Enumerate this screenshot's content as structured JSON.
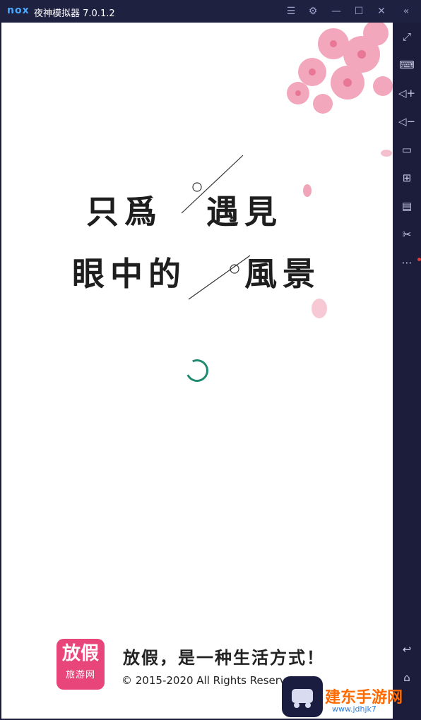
{
  "titlebar": {
    "logo": "nox",
    "title": "夜神模拟器 7.0.1.2"
  },
  "splash": {
    "poem_line1_a": "只爲",
    "poem_line1_b": "遇見",
    "poem_line2_a": "眼中的",
    "poem_line2_b": "風景",
    "brand_main": "放假",
    "brand_sub": "旅游网",
    "slogan": "放假，是一种生活方式！",
    "copyright": "© 2015-2020  All Rights Reserv"
  },
  "watermark": {
    "text": "建东手游网",
    "sub": "www.jdhjk7"
  },
  "colors": {
    "spinner": "#1f8a70",
    "brand": "#e8457b",
    "sidebar": "#1b1d3a"
  }
}
